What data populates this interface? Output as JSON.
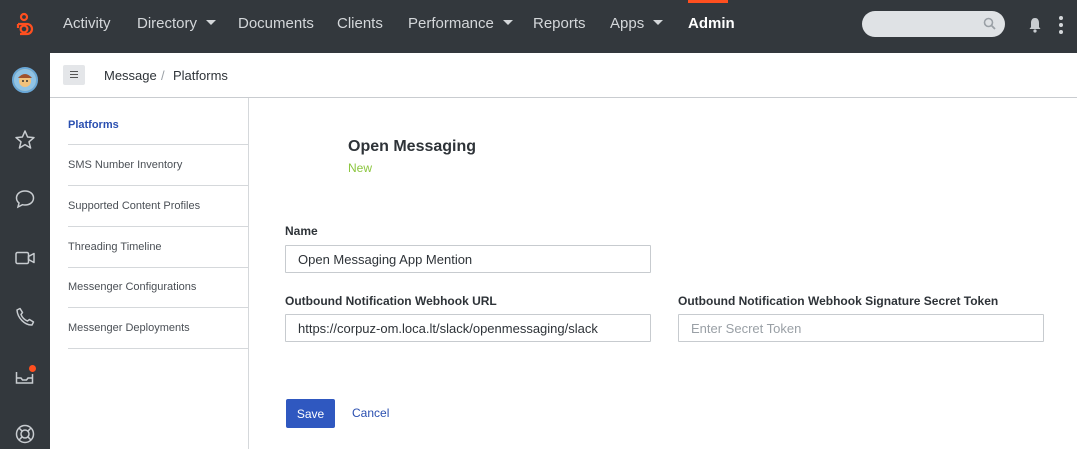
{
  "topnav": {
    "items": [
      {
        "label": "Activity"
      },
      {
        "label": "Directory"
      },
      {
        "label": "Documents"
      },
      {
        "label": "Clients"
      },
      {
        "label": "Performance"
      },
      {
        "label": "Reports"
      },
      {
        "label": "Apps"
      },
      {
        "label": "Admin"
      }
    ],
    "search_placeholder": "",
    "accent_color": "#ff4f1f"
  },
  "leftrail": {
    "icons": [
      "avatar",
      "star-icon",
      "chat-icon",
      "video-icon",
      "phone-icon",
      "inbox-icon",
      "help-icon"
    ]
  },
  "breadcrumb": {
    "items": [
      "Message",
      "Platforms"
    ],
    "separator": "/"
  },
  "subnav": {
    "items": [
      {
        "label": "Platforms"
      },
      {
        "label": "SMS Number Inventory"
      },
      {
        "label": "Supported Content Profiles"
      },
      {
        "label": "Threading Timeline"
      },
      {
        "label": "Messenger Configurations"
      },
      {
        "label": "Messenger Deployments"
      }
    ]
  },
  "form": {
    "title": "Open Messaging",
    "status": "New",
    "name_label": "Name",
    "name_value": "Open Messaging App Mention",
    "webhook_label": "Outbound Notification Webhook URL",
    "webhook_value": "https://corpuz-om.loca.lt/slack/openmessaging/slack",
    "secret_label": "Outbound Notification Webhook Signature Secret Token",
    "secret_placeholder": "Enter Secret Token",
    "save_label": "Save",
    "cancel_label": "Cancel"
  }
}
